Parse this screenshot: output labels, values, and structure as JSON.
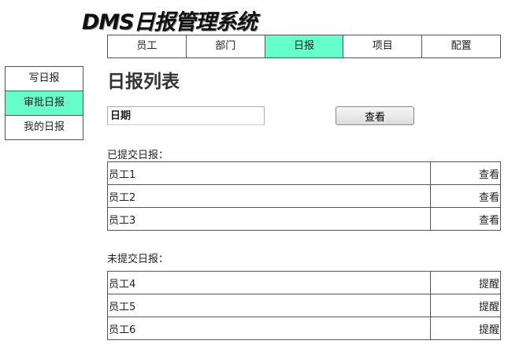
{
  "app": {
    "title": "DMS日报管理系统"
  },
  "topnav": {
    "tabs": [
      "员工",
      "部门",
      "日报",
      "项目",
      "配置"
    ],
    "active_index": 2
  },
  "sidenav": {
    "items": [
      "写日报",
      "审批日报",
      "我的日报"
    ],
    "active_index": 1
  },
  "main": {
    "title": "日报列表",
    "date_input": {
      "placeholder": "日期",
      "value": ""
    },
    "query_button": "查看",
    "submitted": {
      "label": "已提交日报：",
      "rows": [
        {
          "name": "员工1",
          "action": "查看"
        },
        {
          "name": "员工2",
          "action": "查看"
        },
        {
          "name": "员工3",
          "action": "查看"
        }
      ]
    },
    "unsubmitted": {
      "label": "未提交日报：",
      "rows": [
        {
          "name": "员工4",
          "action": "提醒"
        },
        {
          "name": "员工5",
          "action": "提醒"
        },
        {
          "name": "员工6",
          "action": "提醒"
        }
      ]
    }
  },
  "colors": {
    "accent": "#66ffcc",
    "border": "#555555"
  }
}
